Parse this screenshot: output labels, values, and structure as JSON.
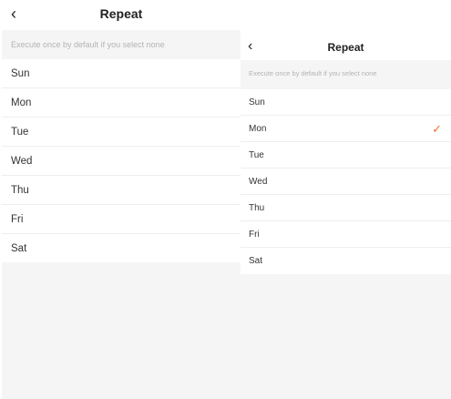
{
  "left_screen": {
    "title": "Repeat",
    "back_glyph": "‹",
    "hint": "Execute once by default if you select none",
    "days": [
      "Sun",
      "Mon",
      "Tue",
      "Wed",
      "Thu",
      "Fri",
      "Sat"
    ]
  },
  "right_screen": {
    "title": "Repeat",
    "back_glyph": "‹",
    "hint": "Execute once by default if you select none",
    "days": [
      "Sun",
      "Mon",
      "Tue",
      "Wed",
      "Thu",
      "Fri",
      "Sat"
    ],
    "selected": "Mon",
    "check_glyph": "✓"
  },
  "colors": {
    "accent": "#ee6d2e",
    "hint_text": "#b3b3b3",
    "background": "#f5f5f5"
  },
  "icons": {
    "back": "chevron-left-icon",
    "selected": "checkmark-icon"
  }
}
